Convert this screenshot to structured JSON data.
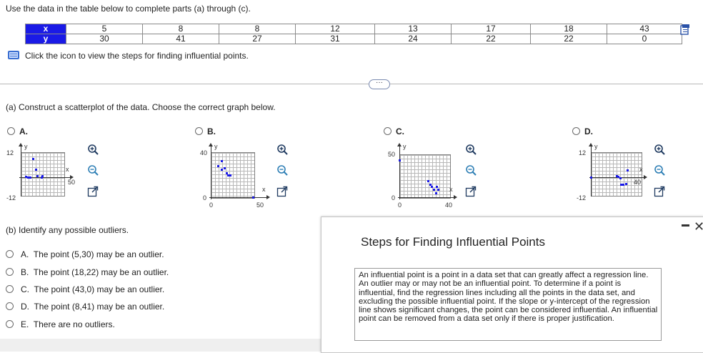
{
  "instructions": "Use the data in the table below to complete parts (a) through (c).",
  "table": {
    "x_label": "x",
    "y_label": "y",
    "x_values": [
      "5",
      "8",
      "8",
      "12",
      "13",
      "17",
      "18",
      "43"
    ],
    "y_values": [
      "30",
      "41",
      "27",
      "31",
      "24",
      "22",
      "22",
      "0"
    ]
  },
  "hint": "Click the icon to view the steps for finding influential points.",
  "more_button": "···",
  "part_a": {
    "prompt": "(a) Construct a scatterplot of the data. Choose the correct graph below.",
    "options": [
      {
        "label": "A.",
        "y_top": "12",
        "y_bottom": "-12",
        "x_tick": "50",
        "x_axis": "x",
        "y_axis": "y"
      },
      {
        "label": "B.",
        "y_top": "40",
        "y_bottom": "0",
        "x_tick": "50",
        "x_origin": "0",
        "x_axis": "x",
        "y_axis": "y"
      },
      {
        "label": "C.",
        "y_top": "50",
        "y_bottom": "0",
        "x_tick": "40",
        "x_origin": "0",
        "x_axis": "x",
        "y_axis": "y"
      },
      {
        "label": "D.",
        "y_top": "12",
        "y_bottom": "-12",
        "x_tick": "40",
        "x_axis": "x",
        "y_axis": "y"
      }
    ]
  },
  "part_b": {
    "prompt": "(b) Identify any possible outliers.",
    "options": [
      {
        "label": "A.",
        "text": "The point (5,30) may be an outlier."
      },
      {
        "label": "B.",
        "text": "The point (18,22) may be an outlier."
      },
      {
        "label": "C.",
        "text": "The point (43,0) may be an outlier."
      },
      {
        "label": "D.",
        "text": "The point (8,41) may be an outlier."
      },
      {
        "label": "E.",
        "text": "There are no outliers."
      }
    ]
  },
  "popup": {
    "title": "Steps for Finding Influential Points",
    "body": "An influential point is a point in a data set that can greatly affect a regression line. An outlier may or may not be an influential point. To determine if a point is influential, find the regression lines including all the points in the data set, and excluding the possible influential point. If the slope or y-intercept of the regression line shows significant changes, the point can be considered influential. An influential point can be removed from a data set only if there is proper justification.",
    "close_glyph": "✕"
  },
  "colors": {
    "table_header_bg": "#1a1ae6",
    "dot": "#1a1ae6",
    "icon_blue": "#2a52a8"
  }
}
